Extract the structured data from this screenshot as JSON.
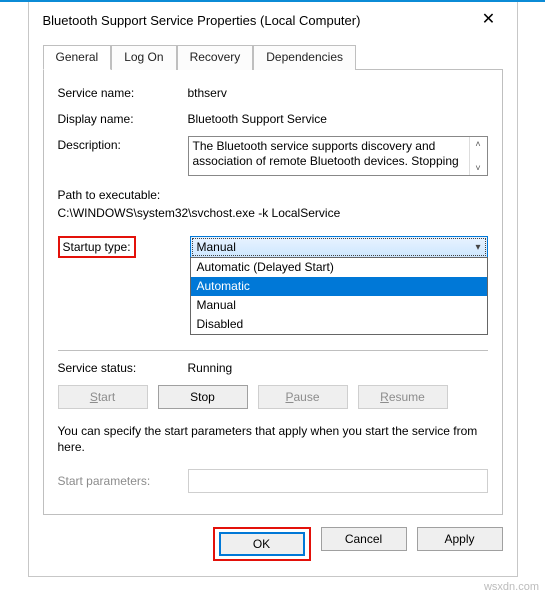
{
  "title": "Bluetooth Support Service Properties (Local Computer)",
  "tabs": {
    "general": "General",
    "logon": "Log On",
    "recovery": "Recovery",
    "dependencies": "Dependencies"
  },
  "labels": {
    "service_name": "Service name:",
    "display_name": "Display name:",
    "description": "Description:",
    "path_label": "Path to executable:",
    "startup_type": "Startup type:",
    "service_status": "Service status:",
    "start_parameters": "Start parameters:"
  },
  "values": {
    "service_name": "bthserv",
    "display_name": "Bluetooth Support Service",
    "description": "The Bluetooth service supports discovery and association of remote Bluetooth devices.  Stopping",
    "path": "C:\\WINDOWS\\system32\\svchost.exe -k LocalService",
    "startup_selected": "Manual",
    "service_status": "Running"
  },
  "dropdown": {
    "opt0": "Automatic (Delayed Start)",
    "opt1": "Automatic",
    "opt2": "Manual",
    "opt3": "Disabled"
  },
  "buttons": {
    "start_pre": "S",
    "start_post": "tart",
    "stop": "Stop",
    "pause_pre": "P",
    "pause_post": "ause",
    "resume_pre": "R",
    "resume_post": "esume",
    "ok": "OK",
    "cancel": "Cancel",
    "apply_pre": "A",
    "apply_post": "pply"
  },
  "helptext": "You can specify the start parameters that apply when you start the service from here.",
  "watermark": "wsxdn.com"
}
